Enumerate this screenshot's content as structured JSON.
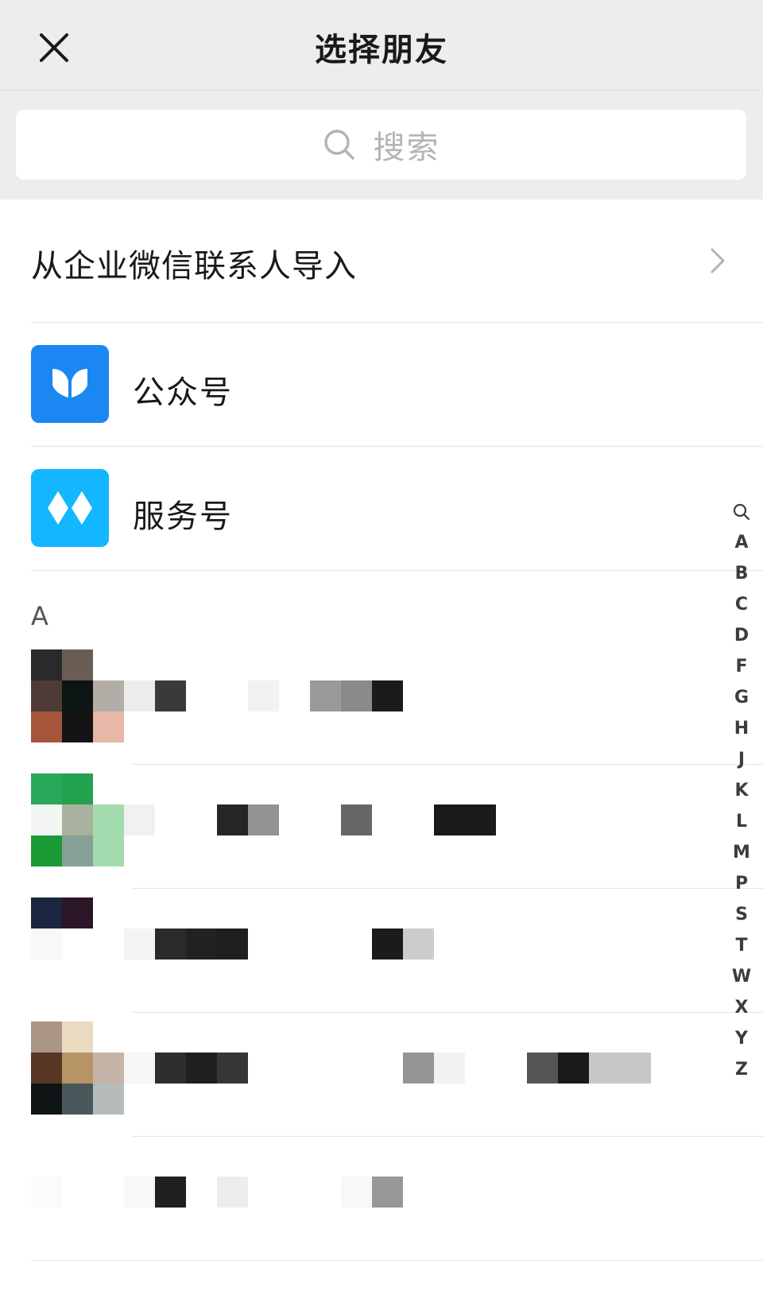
{
  "header": {
    "title": "选择朋友"
  },
  "search": {
    "placeholder": "搜索"
  },
  "import": {
    "label": "从企业微信联系人导入"
  },
  "official_accounts": {
    "label": "公众号"
  },
  "service_accounts": {
    "label": "服务号"
  },
  "section": {
    "letter": "A"
  },
  "index_bar": [
    "A",
    "B",
    "C",
    "D",
    "F",
    "G",
    "H",
    "J",
    "K",
    "L",
    "M",
    "P",
    "S",
    "T",
    "W",
    "X",
    "Y",
    "Z"
  ],
  "colors": {
    "header_bg": "#ededed",
    "official_icon": "#1b87f2",
    "service_icon": "#12b7ff"
  },
  "icons": {
    "close": "close-icon",
    "search": "search-icon",
    "chevron": "chevron-right-icon",
    "official": "official-account-icon",
    "service": "service-account-icon",
    "index_search": "search-icon"
  }
}
